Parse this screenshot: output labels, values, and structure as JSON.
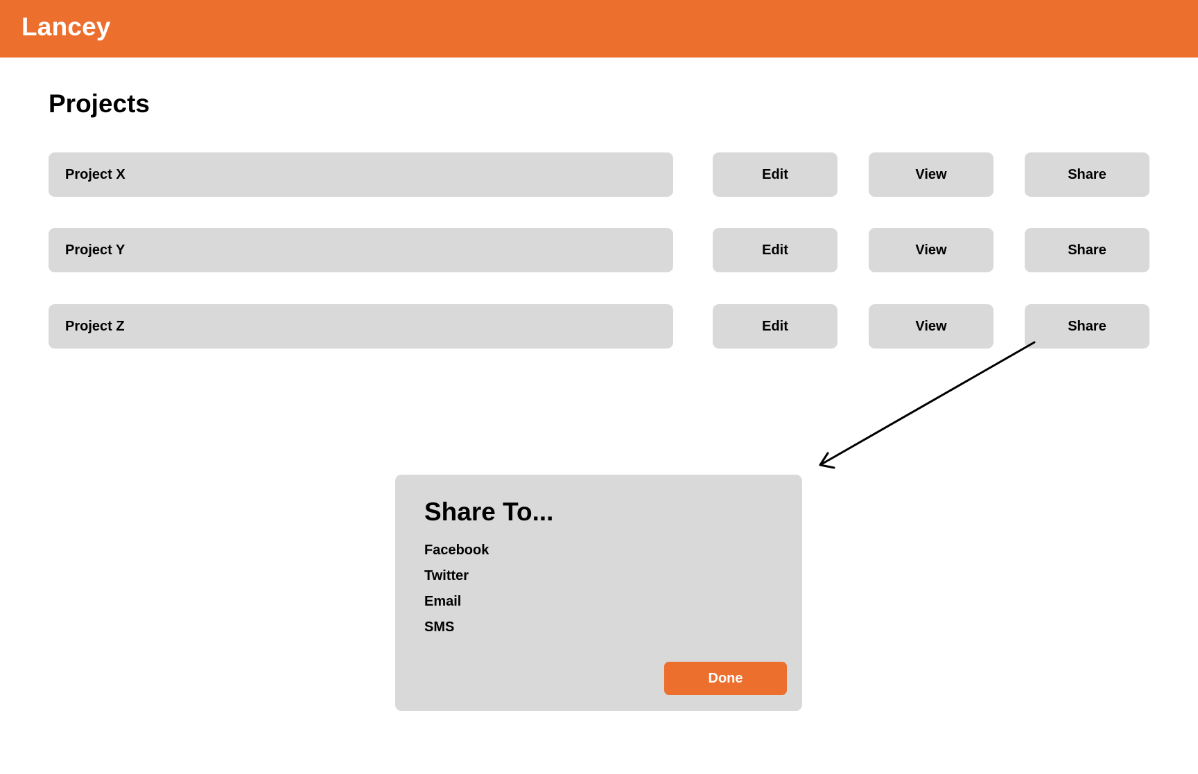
{
  "app": {
    "brand": "Lancey",
    "accent_color": "#ed6f2e"
  },
  "page": {
    "title": "Projects"
  },
  "projects": [
    {
      "name": "Project X",
      "edit_label": "Edit",
      "view_label": "View",
      "share_label": "Share"
    },
    {
      "name": "Project Y",
      "edit_label": "Edit",
      "view_label": "View",
      "share_label": "Share"
    },
    {
      "name": "Project Z",
      "edit_label": "Edit",
      "view_label": "View",
      "share_label": "Share"
    }
  ],
  "share_dialog": {
    "title": "Share To...",
    "options": [
      "Facebook",
      "Twitter",
      "Email",
      "SMS"
    ],
    "done_label": "Done"
  },
  "icons": {
    "connector": "arrow-icon"
  }
}
